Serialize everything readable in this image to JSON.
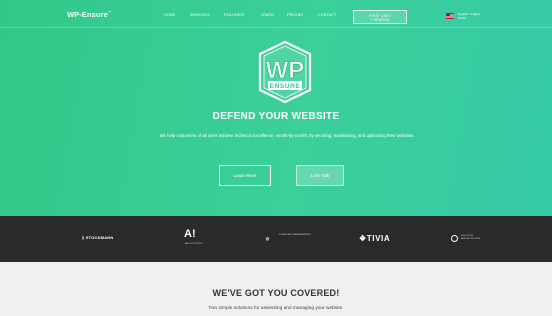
{
  "header": {
    "brand": "WP-Ensure",
    "brand_mark": "™",
    "nav": [
      "HOME",
      "SERVICES",
      "FEATURES",
      "LEARN",
      "PRICING",
      "CONTACT"
    ],
    "cta_line1": "FIRST VISIT",
    "cta_line2": "? SEARCH",
    "lang_line1": "English / Anglais",
    "lang_line2": "Dutch",
    "flag_icon": "us-flag-icon"
  },
  "hero": {
    "logo_letters": "WP",
    "logo_ribbon": "ENSURE",
    "title": "DEFEND YOUR WEBSITE",
    "subtitle": "We help customers of all sizes achieve technical excellence, month-by-month, by securing, maintaining, and optimizing their websites.",
    "btn_learn": "Learn More",
    "btn_talk": "Let's Talk",
    "colors": {
      "gradient_start": "#33c888",
      "gradient_end": "#36c9a6",
      "text": "#ffffff"
    }
  },
  "clients": {
    "c1": "STOCKMANN",
    "c1_icon": "s-mark-icon",
    "c2": "A!",
    "c2_sub": "AALTO-YLIOPISTO",
    "c3_icon": "star-icon",
    "c3_text": "SUOMEN VALTIOVARAINMINISTERIÖ",
    "c4": "TIVIA",
    "c4_icon": "diamond-mark-icon",
    "c5_line1": "KOULUTUS",
    "c5_line2": "AIKUISKOULUTUS",
    "c5_icon": "circle-emblem-icon",
    "background": "#2a2a2a"
  },
  "covered": {
    "title": "WE'VE GOT YOU COVERED!",
    "subtitle": "Two simple solutions for assessing and managing your website."
  }
}
